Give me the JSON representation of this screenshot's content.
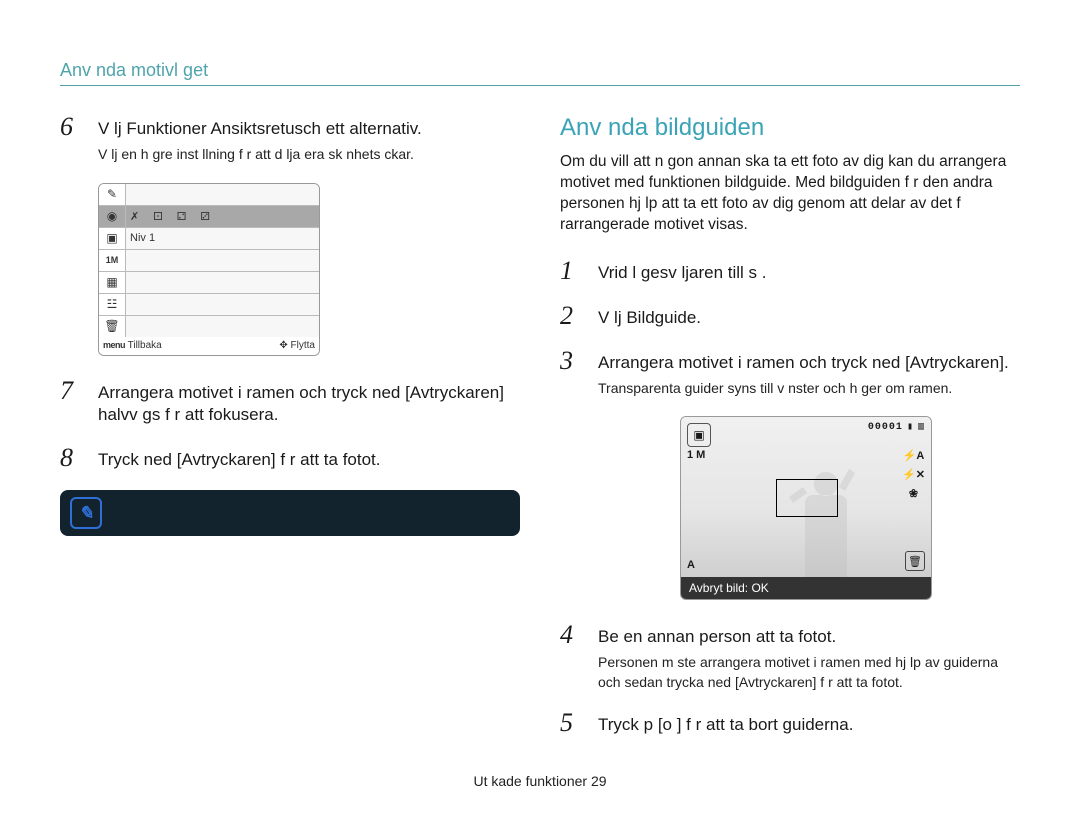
{
  "header": "Anv nda motivl get",
  "left": {
    "step6": {
      "num": "6",
      "text": "V lj Funktioner    Ansiktsretusch     ett alternativ.",
      "sub": "V lj en h gre inst llning f r att d lja  era sk nhets  ckar."
    },
    "screenshot1": {
      "row_hl_label": "Niv  1",
      "footer_left_icon": "menu",
      "footer_left": "Tillbaka",
      "footer_right": "Flytta"
    },
    "step7": {
      "num": "7",
      "text": "Arrangera motivet i ramen och tryck ned [Avtryckaren] halvv gs f r att fokusera."
    },
    "step8": {
      "num": "8",
      "text": "Tryck ned [Avtryckaren] f r att ta fotot."
    }
  },
  "right": {
    "title": "Anv nda bildguiden",
    "intro": "Om du vill att n gon annan ska ta ett foto av dig kan du arrangera motivet med funktionen bildguide. Med bildguiden f r den andra personen hj lp att ta ett foto av dig genom att delar av det f rarrangerade motivet visas.",
    "step1": {
      "num": "1",
      "text": "Vrid l gesv ljaren till s    ."
    },
    "step2": {
      "num": "2",
      "text": "V lj Bildguide."
    },
    "step3": {
      "num": "3",
      "text": "Arrangera motivet i ramen och tryck ned [Avtryckaren].",
      "sub": "Transparenta guider syns till v nster och h ger om ramen."
    },
    "screenshot2": {
      "counter": "00001",
      "mode": "1 M",
      "auto": "A",
      "footer": "Avbryt bild: OK"
    },
    "step4": {
      "num": "4",
      "text": "Be en annan person att ta fotot.",
      "sub": "Personen m ste arrangera motivet i ramen med hj lp av guiderna och sedan trycka ned [Avtryckaren] f r att ta fotot."
    },
    "step5": {
      "num": "5",
      "text": "Tryck p  [o   ] f r att ta bort guiderna."
    }
  },
  "footer": {
    "section": "Ut kade funktioner",
    "page": "29"
  }
}
